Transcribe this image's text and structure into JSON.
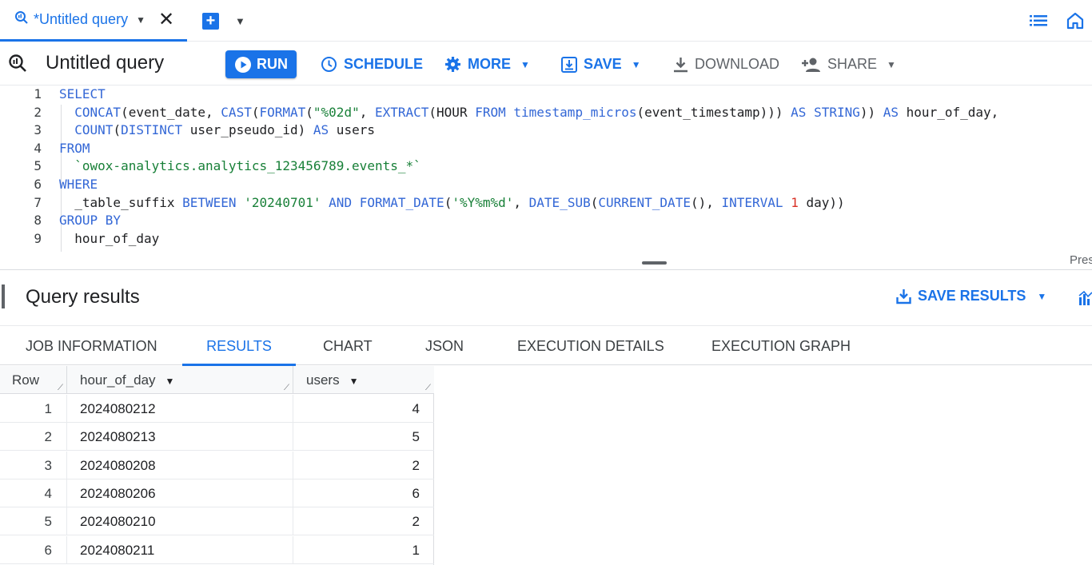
{
  "tabbar": {
    "tab_title": "*Untitled query"
  },
  "toolbar": {
    "title": "Untitled query",
    "run": "RUN",
    "schedule": "SCHEDULE",
    "more": "MORE",
    "save": "SAVE",
    "download": "DOWNLOAD",
    "share": "SHARE"
  },
  "editor": {
    "lines": [
      {
        "n": "1",
        "code": "<span class=\"kw\">SELECT</span>"
      },
      {
        "n": "2",
        "code": "  <span class=\"kw\">CONCAT</span>(event_date, <span class=\"kw\">CAST</span>(<span class=\"kw\">FORMAT</span>(<span class=\"str\">\"%02d\"</span>, <span class=\"kw\">EXTRACT</span>(HOUR <span class=\"kw\">FROM</span> <span class=\"kw\">timestamp_micros</span>(event_timestamp))) <span class=\"kw\">AS</span> <span class=\"kw\">STRING</span>)) <span class=\"kw\">AS</span> hour_of_day,"
      },
      {
        "n": "3",
        "code": "  <span class=\"kw\">COUNT</span>(<span class=\"kw\">DISTINCT</span> user_pseudo_id) <span class=\"kw\">AS</span> users"
      },
      {
        "n": "4",
        "code": "<span class=\"kw\">FROM</span>"
      },
      {
        "n": "5",
        "code": "  <span class=\"str\">`owox-analytics.analytics_123456789.events_*`</span>"
      },
      {
        "n": "6",
        "code": "<span class=\"kw\">WHERE</span>"
      },
      {
        "n": "7",
        "code": "  _table_suffix <span class=\"kw\">BETWEEN</span> <span class=\"str\">'20240701'</span> <span class=\"kw\">AND</span> <span class=\"kw\">FORMAT_DATE</span>(<span class=\"str\">'%Y%m%d'</span>, <span class=\"kw\">DATE_SUB</span>(<span class=\"kw\">CURRENT_DATE</span>(), <span class=\"kw\">INTERVAL</span> <span class=\"num\">1</span> day))"
      },
      {
        "n": "8",
        "code": "<span class=\"kw\">GROUP BY</span>"
      },
      {
        "n": "9",
        "code": "  hour_of_day"
      }
    ],
    "press_hint": "Pres"
  },
  "results": {
    "title": "Query results",
    "save_results": "SAVE RESULTS",
    "tabs": [
      "JOB INFORMATION",
      "RESULTS",
      "CHART",
      "JSON",
      "EXECUTION DETAILS",
      "EXECUTION GRAPH"
    ],
    "active_tab": "RESULTS",
    "columns": [
      "Row",
      "hour_of_day",
      "users"
    ],
    "rows": [
      {
        "row": "1",
        "hour_of_day": "2024080212",
        "users": "4"
      },
      {
        "row": "2",
        "hour_of_day": "2024080213",
        "users": "5"
      },
      {
        "row": "3",
        "hour_of_day": "2024080208",
        "users": "2"
      },
      {
        "row": "4",
        "hour_of_day": "2024080206",
        "users": "6"
      },
      {
        "row": "5",
        "hour_of_day": "2024080210",
        "users": "2"
      },
      {
        "row": "6",
        "hour_of_day": "2024080211",
        "users": "1"
      }
    ]
  },
  "colors": {
    "accent": "#1a73e8",
    "keyword": "#3367d6",
    "string": "#188038",
    "number": "#d93025"
  }
}
